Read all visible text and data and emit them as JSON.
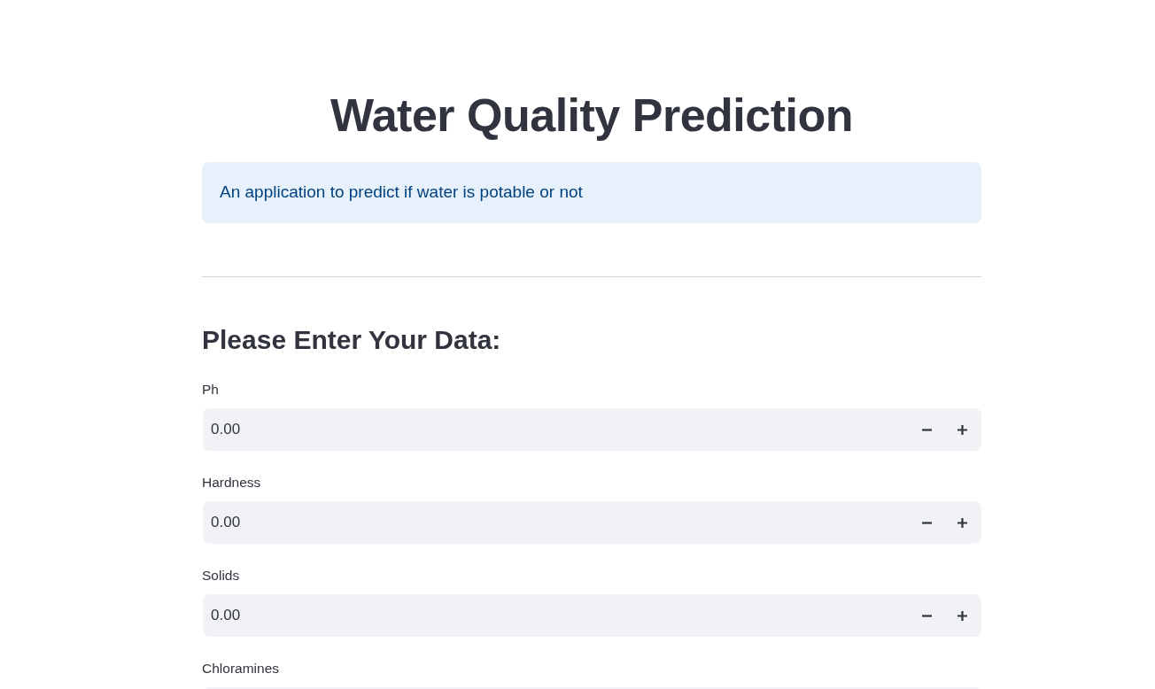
{
  "title": "Water Quality Prediction",
  "info": {
    "text": "An application to predict if water is potable or not"
  },
  "form": {
    "heading": "Please Enter Your Data:",
    "fields": [
      {
        "label": "Ph",
        "value": "0.00"
      },
      {
        "label": "Hardness",
        "value": "0.00"
      },
      {
        "label": "Solids",
        "value": "0.00"
      },
      {
        "label": "Chloramines"
      }
    ]
  }
}
